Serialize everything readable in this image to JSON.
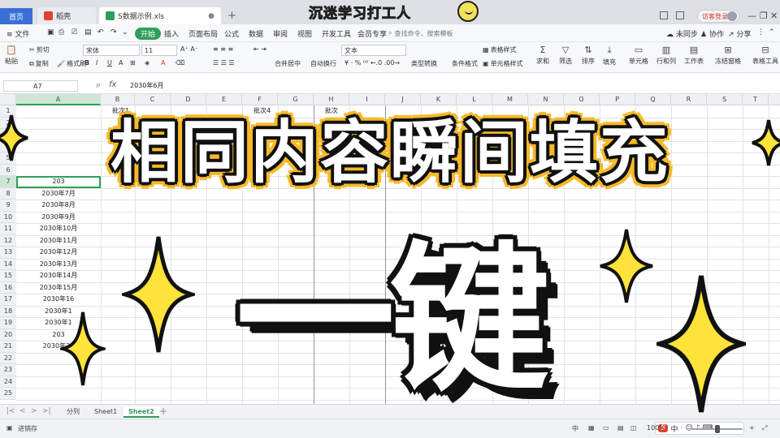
{
  "titlebar": {
    "tabs": [
      {
        "label": "首页"
      },
      {
        "label": "稻壳"
      },
      {
        "label": "S数据示例.xls"
      }
    ],
    "new_tab": "+",
    "user_button": "访客登录"
  },
  "overlay": {
    "top_banner": "沉迷学习打工人",
    "title": "相同内容瞬间填充",
    "key_text": "一键"
  },
  "menubar": {
    "file_menu": "文件",
    "items": [
      "开始",
      "插入",
      "页面布局",
      "公式",
      "数据",
      "审阅",
      "视图",
      "开发工具",
      "会员专享"
    ],
    "search_placeholder": "查找命令、搜索模板",
    "right": [
      "未同步",
      "协作",
      "分享"
    ]
  },
  "ribbon": {
    "paste": "粘贴",
    "cut": "剪切",
    "copy": "复制",
    "format_painter": "格式刷",
    "font_name": "宋体",
    "font_size": "11",
    "merge_center": "合并居中",
    "wrap_text": "自动换行",
    "number_format": "文本",
    "type_convert": "类型转换",
    "conditional_format": "条件格式",
    "table_style": "表格样式",
    "cell_style": "单元格样式",
    "sum": "求和",
    "filter": "筛选",
    "sort": "排序",
    "fill": "填充",
    "cell": "单元格",
    "row_col": "行和列",
    "worksheet": "工作表",
    "freeze": "冻结窗格",
    "table_tools": "表格工具"
  },
  "formulabar": {
    "name_box": "A7",
    "fx": "fx",
    "value": "2030年6月"
  },
  "grid": {
    "columns": [
      "A",
      "B",
      "C",
      "D",
      "E",
      "F",
      "G",
      "H",
      "I",
      "J",
      "K",
      "L",
      "M",
      "N",
      "O",
      "P",
      "Q",
      "R",
      "S",
      "T"
    ],
    "row_numbers": [
      "1",
      "2",
      "3",
      "4",
      "5",
      "6",
      "7",
      "8",
      "9",
      "10",
      "11",
      "12",
      "13",
      "14",
      "15",
      "16",
      "17",
      "18",
      "19",
      "20",
      "21",
      "22",
      "23",
      "24",
      "25"
    ],
    "header_cells": [
      "批次1",
      "批次4",
      "批次"
    ],
    "column_a": [
      "",
      "",
      "",
      "",
      "",
      "",
      "203",
      "2030年7月",
      "2030年8月",
      "2030年9月",
      "2030年10月",
      "2030年11月",
      "2030年12月",
      "2030年13月",
      "2030年14月",
      "2030年15月",
      "2030年16",
      "2030年1",
      "2030年1",
      "203",
      "2030年20",
      "",
      "",
      "",
      ""
    ]
  },
  "sheetbar": {
    "nav": [
      "|<",
      "<",
      ">",
      ">|"
    ],
    "tabs": [
      "分列",
      "Sheet1",
      "Sheet2"
    ],
    "active": "Sheet2",
    "add": "+"
  },
  "statusbar": {
    "left": "进销存",
    "ime_items": [
      "S",
      "中",
      "·",
      "☺"
    ],
    "input_mode": "中",
    "zoom": "100%"
  },
  "colors": {
    "accent_green": "#2f9e5b",
    "overlay_yellow": "#f7b928",
    "outline_black": "#111111"
  }
}
